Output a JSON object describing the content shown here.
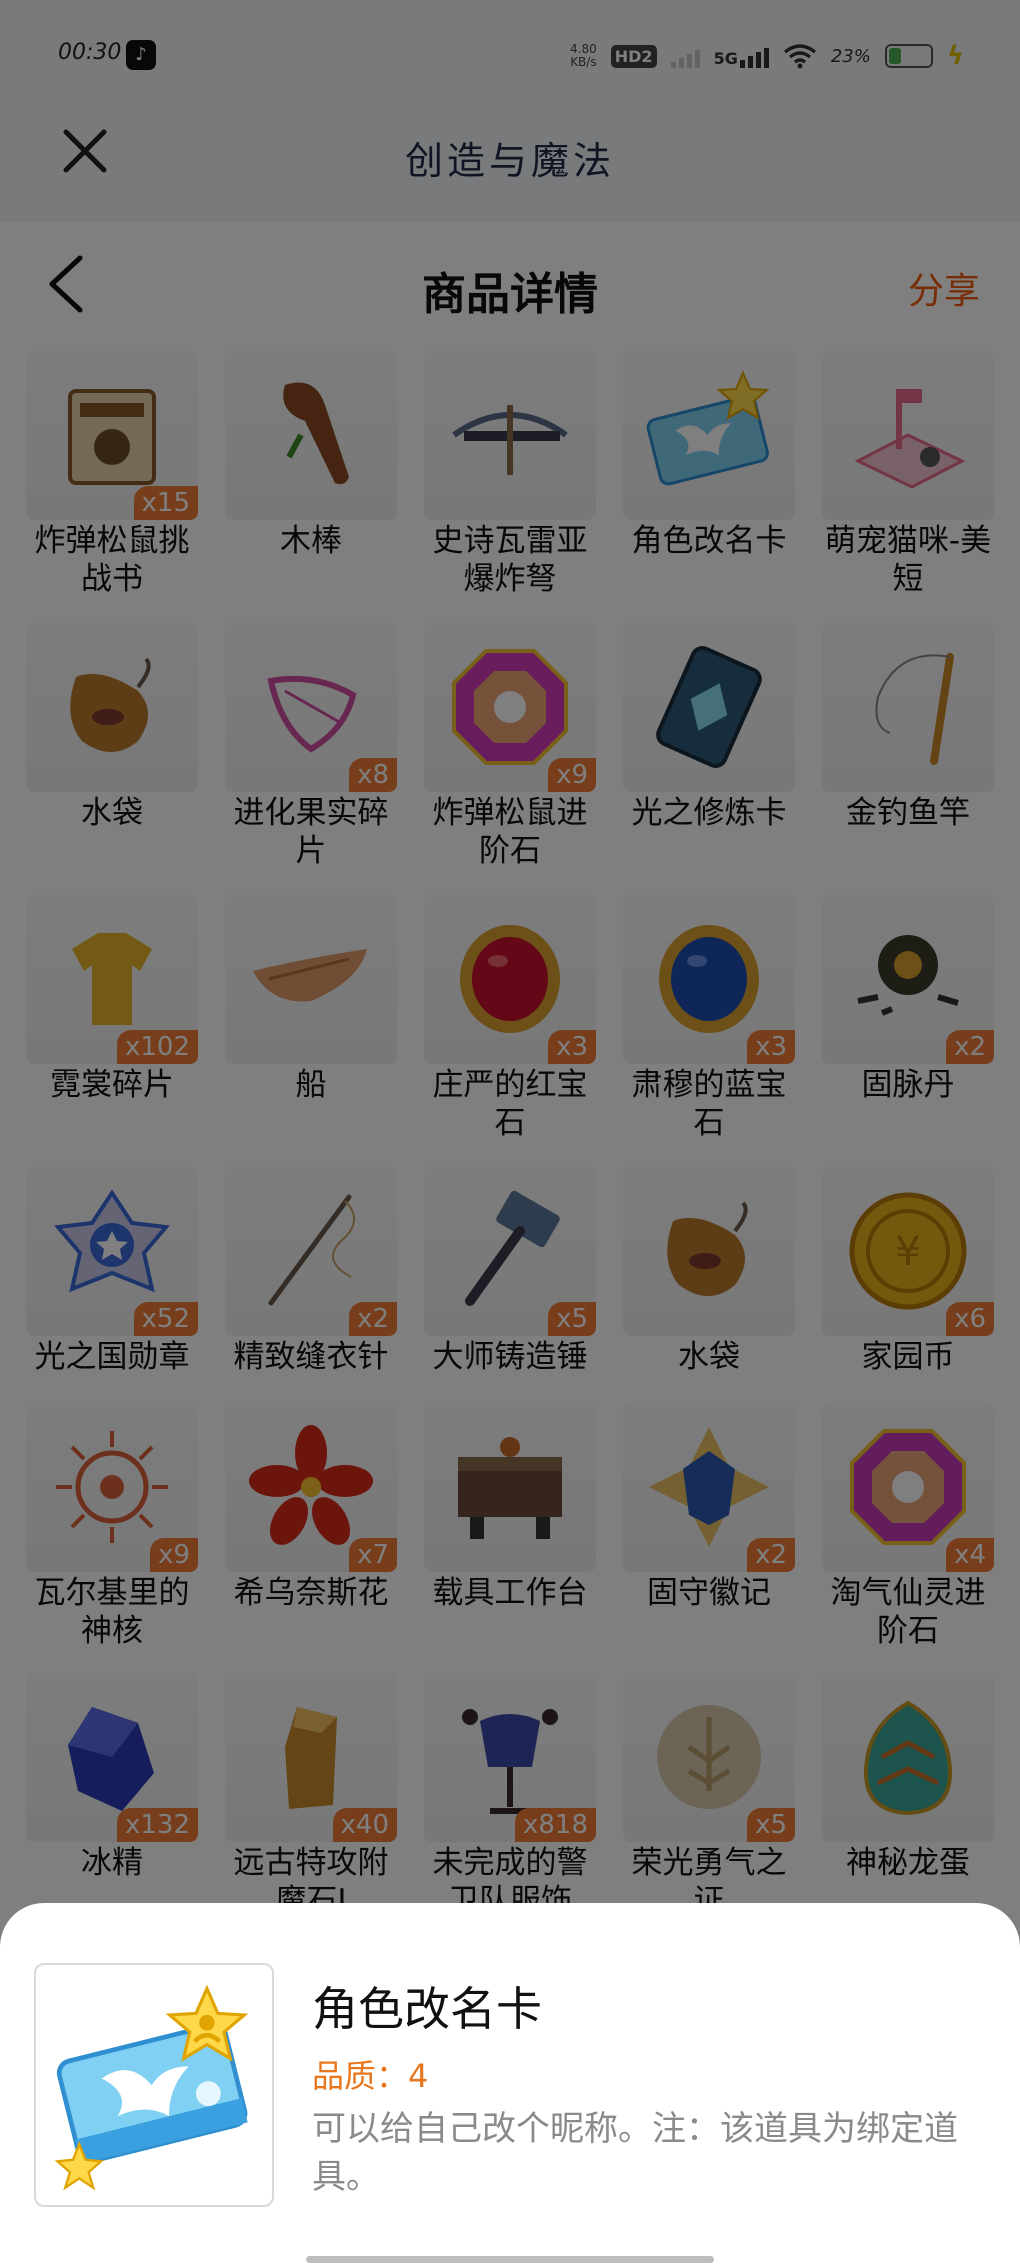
{
  "status_bar": {
    "time": "00:30",
    "net_speed": "4.80",
    "net_unit": "KB/s",
    "hd": "HD2",
    "network": "5G",
    "battery": "23%"
  },
  "app": {
    "title": "创造与魔法"
  },
  "header": {
    "title": "商品详情",
    "share": "分享"
  },
  "items": [
    {
      "name": "炸弹松鼠挑战书",
      "count": "x15",
      "icon": "wanted-poster-icon",
      "color": "#8a5a2b"
    },
    {
      "name": "木棒",
      "count": "",
      "icon": "wooden-club-icon",
      "color": "#8b4a22"
    },
    {
      "name": "史诗瓦雷亚爆炸弩",
      "count": "",
      "icon": "crossbow-icon",
      "color": "#5a6a8a"
    },
    {
      "name": "角色改名卡",
      "count": "",
      "icon": "rename-card-icon",
      "color": "#3fa9e0"
    },
    {
      "name": "萌宠猫咪-美短",
      "count": "",
      "icon": "cat-bed-icon",
      "color": "#e76a8a"
    },
    {
      "name": "水袋",
      "count": "",
      "icon": "water-bag-icon",
      "color": "#b97a2a"
    },
    {
      "name": "进化果实碎片",
      "count": "x8",
      "icon": "fruit-shard-icon",
      "color": "#d04fa0"
    },
    {
      "name": "炸弹松鼠进阶石",
      "count": "x9",
      "icon": "gem-stone-icon",
      "color": "#d23ab8"
    },
    {
      "name": "光之修炼卡",
      "count": "",
      "icon": "light-card-icon",
      "color": "#2a5a7a"
    },
    {
      "name": "金钓鱼竿",
      "count": "",
      "icon": "fishing-rod-icon",
      "color": "#c8862a"
    },
    {
      "name": "霓裳碎片",
      "count": "x102",
      "icon": "shirt-shard-icon",
      "color": "#e8b22a"
    },
    {
      "name": "船",
      "count": "",
      "icon": "boat-icon",
      "color": "#e09a6a"
    },
    {
      "name": "庄严的红宝石",
      "count": "x3",
      "icon": "ruby-icon",
      "color": "#c8102e"
    },
    {
      "name": "肃穆的蓝宝石",
      "count": "x3",
      "icon": "sapphire-icon",
      "color": "#1e4fb0"
    },
    {
      "name": "固脉丹",
      "count": "x2",
      "icon": "pill-icon",
      "color": "#3a3a2a"
    },
    {
      "name": "光之国勋章",
      "count": "x52",
      "icon": "medal-icon",
      "color": "#3a6ad8"
    },
    {
      "name": "精致缝衣针",
      "count": "x2",
      "icon": "needle-icon",
      "color": "#6a5a4a"
    },
    {
      "name": "大师铸造锤",
      "count": "x5",
      "icon": "hammer-icon",
      "color": "#5a7a9a"
    },
    {
      "name": "水袋",
      "count": "",
      "icon": "water-bag-icon",
      "color": "#b97a2a"
    },
    {
      "name": "家园币",
      "count": "x6",
      "icon": "coin-icon",
      "color": "#e8b01a"
    },
    {
      "name": "瓦尔基里的神核",
      "count": "x9",
      "icon": "sun-emblem-icon",
      "color": "#d8603a"
    },
    {
      "name": "希乌奈斯花",
      "count": "x7",
      "icon": "flower-icon",
      "color": "#d82a1a"
    },
    {
      "name": "载具工作台",
      "count": "",
      "icon": "workbench-icon",
      "color": "#6a4a3a"
    },
    {
      "name": "固守徽记",
      "count": "x2",
      "icon": "shield-badge-icon",
      "color": "#2a5ab0"
    },
    {
      "name": "淘气仙灵进阶石",
      "count": "x4",
      "icon": "gem-stone-icon",
      "color": "#c83ab8"
    },
    {
      "name": "冰精",
      "count": "x132",
      "icon": "ice-crystal-icon",
      "color": "#2a3ab8"
    },
    {
      "name": "远古特攻附魔石I",
      "count": "x40",
      "icon": "amber-stone-icon",
      "color": "#c88a2a"
    },
    {
      "name": "未完成的警卫队服饰",
      "count": "x818",
      "icon": "armor-stand-icon",
      "color": "#3a4aa8"
    },
    {
      "name": "荣光勇气之证",
      "count": "x5",
      "icon": "tiger-badge-icon",
      "color": "#d8c8a8"
    },
    {
      "name": "神秘龙蛋",
      "count": "",
      "icon": "dragon-egg-icon",
      "color": "#3aa89a"
    }
  ],
  "detail": {
    "title": "角色改名卡",
    "quality": "品质：4",
    "description": "可以给自己改个昵称。注：该道具为绑定道具。",
    "icon": "rename-card-icon"
  }
}
